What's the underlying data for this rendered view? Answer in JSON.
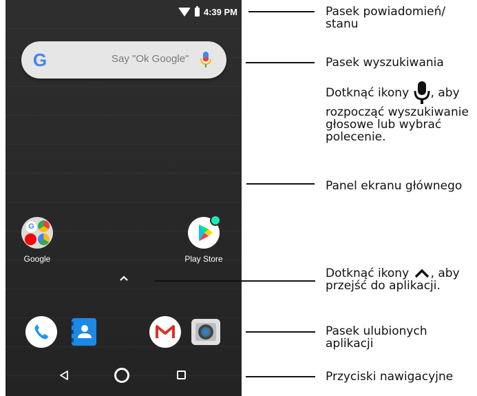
{
  "status_bar": {
    "time": "4:39 PM"
  },
  "search_bar": {
    "placeholder": "Say \"Ok Google\""
  },
  "home_apps": [
    {
      "label": "Google"
    },
    {
      "label": "Play Store"
    }
  ],
  "callouts": {
    "status": "Pasek powiadomień/ stanu",
    "search": "Pasek wyszukiwania",
    "voice_part1": "Dotknąć ikony",
    "voice_part2": ", aby rozpocząć wyszukiwanie głosowe lub wybrać polecenie.",
    "home_panel": "Panel ekranu głównego",
    "apps_part1": "Dotknąć ikony",
    "apps_part2": ", aby przejść do aplikacji.",
    "favorites": "Pasek ulubionych aplikacji",
    "navigation": "Przyciski nawigacyjne"
  },
  "icons": {
    "wifi": "wifi-icon",
    "battery": "battery-icon",
    "google": "google-g-icon",
    "mic": "mic-icon",
    "google_folder": "google-folder-icon",
    "play_store": "play-store-icon",
    "app_drawer": "chevron-up-icon",
    "phone": "phone-icon",
    "contacts": "contacts-icon",
    "gmail": "gmail-icon",
    "camera": "camera-icon",
    "back": "back-icon",
    "home": "home-icon",
    "recents": "recents-icon"
  }
}
